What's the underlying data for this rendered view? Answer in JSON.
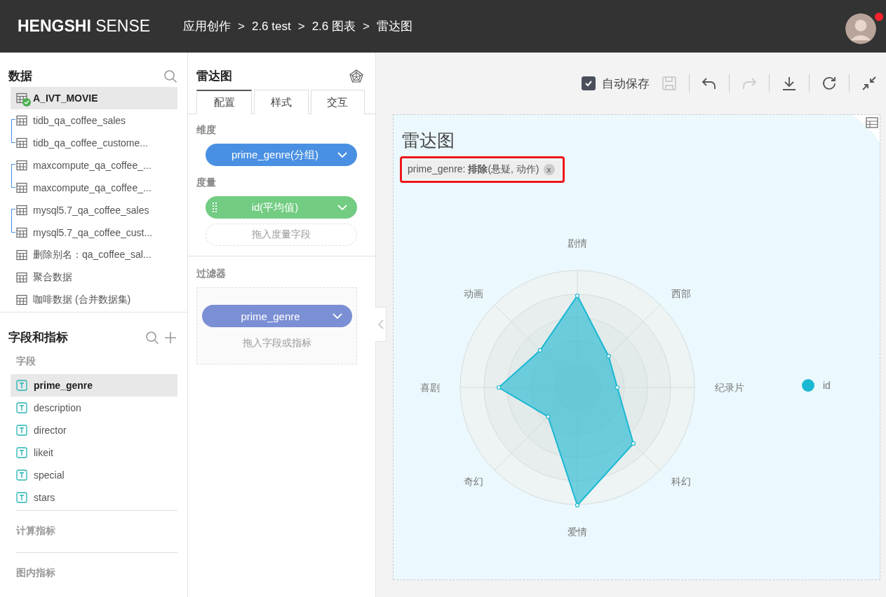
{
  "header": {
    "logo": "**HENGSHI** SENSE",
    "breadcrumbs": [
      {
        "label": "应用创作"
      },
      {
        "separator": ">",
        "label": "2.6 test"
      },
      {
        "separator": ">",
        "label": "2.6 图表"
      },
      {
        "separator": ">",
        "label": "雷达图"
      }
    ],
    "notification": true
  },
  "data_panel": {
    "title": "数据",
    "groups": [
      {
        "kind": "single",
        "items": [
          {
            "label": "A_IVT_MOVIE",
            "selected": true,
            "ready": true
          }
        ]
      },
      {
        "kind": "linked",
        "items": [
          {
            "label": "tidb_qa_coffee_sales",
            "selected": false,
            "ready": false
          },
          {
            "label": "tidb_qa_coffee_custome...",
            "selected": false,
            "ready": false
          }
        ]
      },
      {
        "kind": "linked",
        "items": [
          {
            "label": "maxcompute_qa_coffee_...",
            "selected": false,
            "ready": false
          },
          {
            "label": "maxcompute_qa_coffee_...",
            "selected": false,
            "ready": false
          }
        ]
      },
      {
        "kind": "linked",
        "items": [
          {
            "label": "mysql5.7_qa_coffee_sales",
            "selected": false,
            "ready": false
          },
          {
            "label": "mysql5.7_qa_coffee_cust...",
            "selected": false,
            "ready": false
          }
        ]
      },
      {
        "kind": "single",
        "items": [
          {
            "label": "删除别名：qa_coffee_sal...",
            "selected": false,
            "ready": false
          },
          {
            "label": "聚合数据",
            "selected": false,
            "ready": false
          },
          {
            "label": "咖啡数据 (合并数据集)",
            "selected": false,
            "ready": false
          }
        ]
      }
    ]
  },
  "fields_panel": {
    "title": "字段和指标",
    "sections": [
      {
        "title": "字段",
        "items": [
          {
            "label": "prime_genre",
            "selected": true
          },
          {
            "label": "description",
            "selected": false
          },
          {
            "label": "director",
            "selected": false
          },
          {
            "label": "likeit",
            "selected": false
          },
          {
            "label": "special",
            "selected": false
          },
          {
            "label": "stars",
            "selected": false
          }
        ]
      },
      {
        "title": "计算指标"
      },
      {
        "title": "图内指标"
      }
    ]
  },
  "config_panel": {
    "title": "雷达图",
    "tabs": [
      {
        "label": "配置",
        "selected": true
      },
      {
        "label": "样式",
        "selected": false
      },
      {
        "label": "交互",
        "selected": false
      }
    ],
    "dimension": {
      "title": "维度",
      "pills": [
        {
          "label": "prime_genre(分组)",
          "color": "#4a90e2"
        }
      ]
    },
    "measure": {
      "title": "度量",
      "pills": [
        {
          "label": "id(平均值)",
          "color": "#72cc82",
          "handle": true
        }
      ],
      "drop_hint": "拖入度量字段"
    },
    "filter": {
      "title": "过滤器",
      "pills": [
        {
          "label": "prime_genre",
          "color": "#7b8fd4"
        }
      ],
      "drop_hint": "拖入字段或指标"
    }
  },
  "toolbar": {
    "autosave": {
      "label": "自动保存",
      "checked": true
    },
    "buttons": [
      {
        "kind": "save",
        "disabled": true
      },
      {
        "kind": "undo",
        "disabled": false
      },
      {
        "kind": "redo",
        "disabled": true
      },
      {
        "kind": "download",
        "disabled": false
      },
      {
        "kind": "refresh",
        "disabled": false
      },
      {
        "kind": "collapse",
        "disabled": false
      }
    ]
  },
  "chart": {
    "title": "雷达图",
    "filter_tag": {
      "text": "prime_genre: **排除**(悬疑, 动作)",
      "close": "x",
      "highlighted": true
    },
    "axes": [
      "剧情",
      "西部",
      "纪录片",
      "科幻",
      "爱情",
      "奇幻",
      "喜剧",
      "动画"
    ],
    "legend": [
      {
        "label": "id",
        "color": "#1ab8d2"
      }
    ]
  }
}
